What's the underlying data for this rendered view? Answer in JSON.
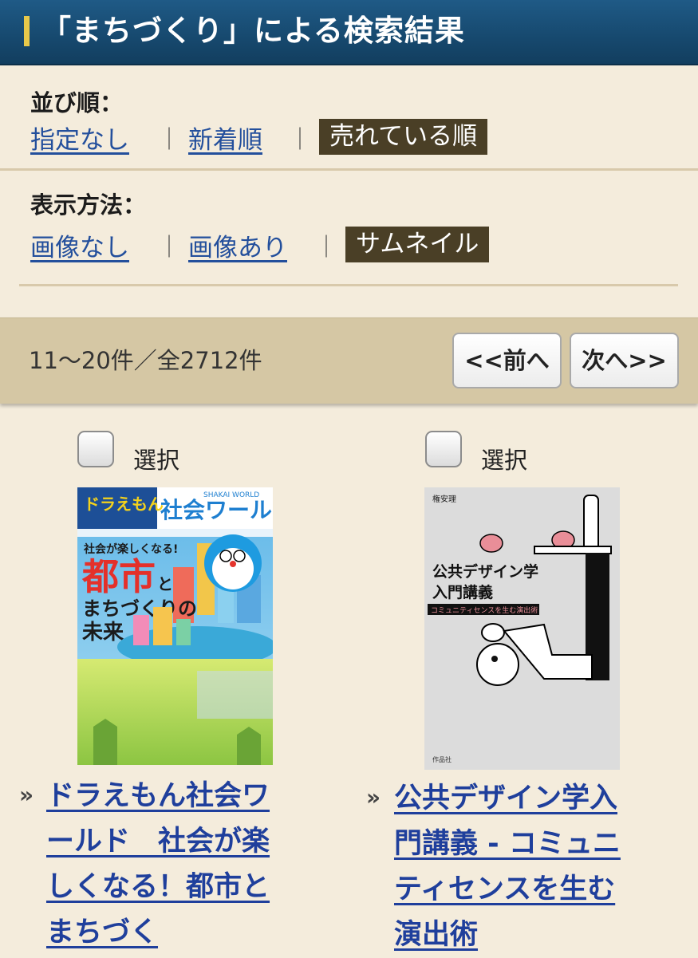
{
  "header": {
    "title": "「まちづくり」による検索結果"
  },
  "sort": {
    "label": "並び順：",
    "options": [
      "指定なし",
      "新着順"
    ],
    "active": "売れている順",
    "separator": "｜"
  },
  "display": {
    "label": "表示方法：",
    "options": [
      "画像なし",
      "画像あり"
    ],
    "active": "サムネイル",
    "separator": "｜"
  },
  "pager": {
    "count": "11〜20件／全2712件",
    "prev_label": "<<前へ",
    "next_label": "次へ>>"
  },
  "results": [
    {
      "select_label": "選択",
      "title": "ドラえもん社会ワールド　社会が楽しくなる！都市とまちづく",
      "cover": {
        "series": "ドラえもん",
        "series_label": "社会ワールド",
        "series_en": "SHAKAI WORLD",
        "tagline": "社会が楽しくなる!",
        "title_main": "都市",
        "title_to": "と",
        "title_sub": "まちづくりの",
        "title_end": "未来"
      }
    },
    {
      "select_label": "選択",
      "title": "公共デザイン学入門講義 - コミュニティセンスを生む演出術",
      "cover": {
        "author": "権安理",
        "title_line1": "公共デザイン学",
        "title_line2": "入門講義",
        "subtitle": "コミュニティセンスを生む演出術",
        "publisher": "作品社"
      }
    }
  ],
  "colors": {
    "header_bg": "#174a70",
    "accent": "#e7c84a",
    "link": "#234f9c",
    "active_bg": "#4a3f26",
    "page_bg": "#f4ecdc"
  }
}
